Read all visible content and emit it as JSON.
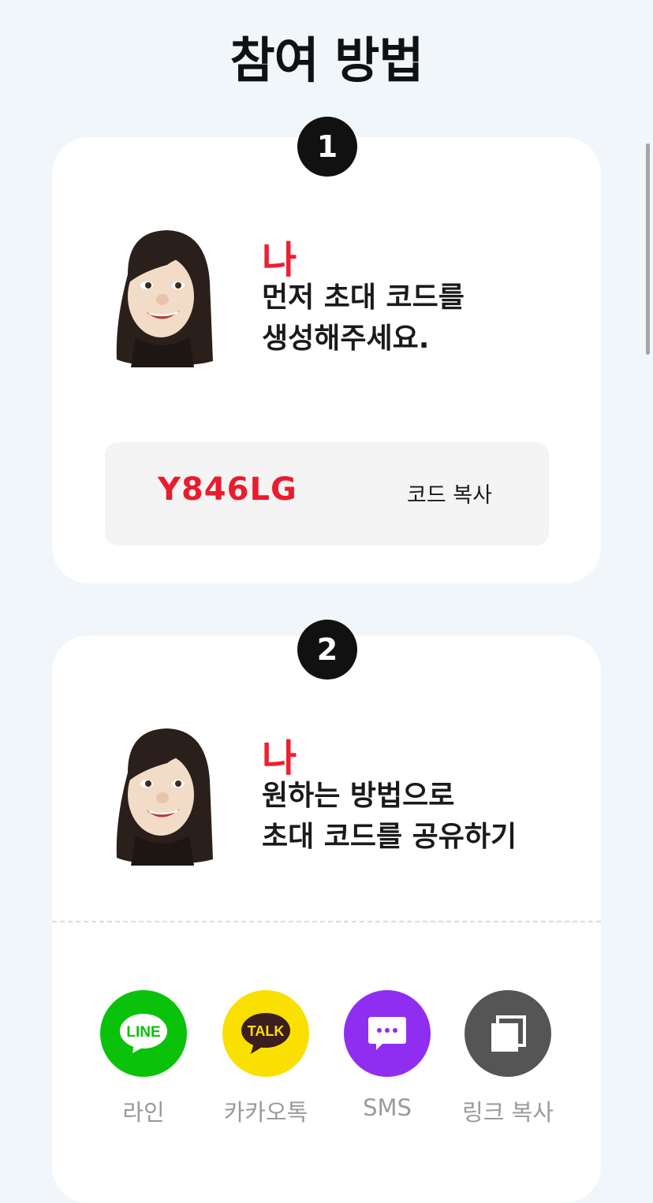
{
  "page": {
    "title": "참여 방법"
  },
  "steps": [
    {
      "number": "1",
      "who": "나",
      "line1": "먼저 초대 코드를",
      "line2": "생성해주세요."
    },
    {
      "number": "2",
      "who": "나",
      "line1": "원하는 방법으로",
      "line2": "초대 코드를 공유하기"
    }
  ],
  "invite": {
    "code": "Y846LG",
    "copy_label": "코드 복사"
  },
  "share": [
    {
      "label": "라인",
      "icon": "line-icon",
      "icon_text": "LINE",
      "color": "#0bc20a"
    },
    {
      "label": "카카오톡",
      "icon": "kakaotalk-icon",
      "icon_text": "TALK",
      "color": "#f9e000"
    },
    {
      "label": "SMS",
      "icon": "sms-icon",
      "color": "#8f2ef0"
    },
    {
      "label": "링크 복사",
      "icon": "copy-link-icon",
      "color": "#555555"
    }
  ],
  "colors": {
    "accent": "#f21d2f",
    "background": "#f0f6f9"
  }
}
